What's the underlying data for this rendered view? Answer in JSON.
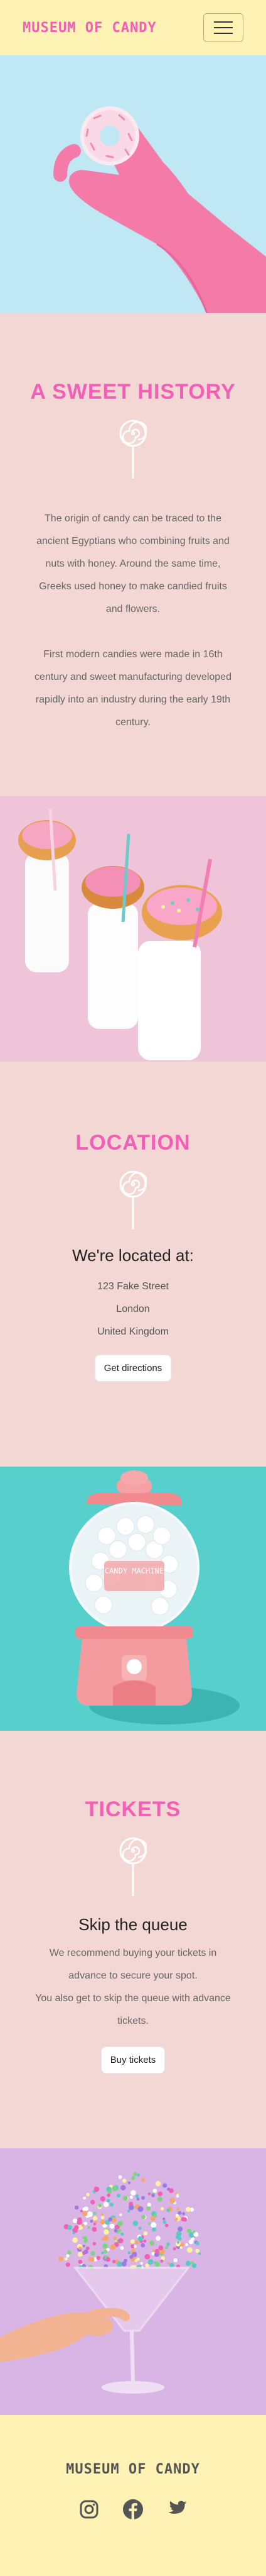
{
  "header": {
    "logo": "MUSEUM OF CANDY",
    "menu_icon": "hamburger-menu-icon"
  },
  "hero": {
    "image": "hand-in-pink-glove-holding-donut"
  },
  "history": {
    "heading": "A SWEET HISTORY",
    "icon": "lollipop-icon",
    "paragraph1": "The origin of candy can be traced to the ancient Egyptians who combining fruits and nuts with honey. Around the same time, Greeks used honey to make candied fruits and flowers.",
    "paragraph2": "First modern candies were made in 16th century and sweet manufacturing developed rapidly into an industry during the early 19th century."
  },
  "image2": {
    "image": "milk-bottles-with-donuts"
  },
  "location": {
    "heading": "LOCATION",
    "icon": "lollipop-icon",
    "subheading": "We're located at:",
    "address": [
      "123 Fake Street",
      "London",
      "United Kingdom"
    ],
    "button": "Get directions"
  },
  "image3": {
    "image": "pink-candy-machine",
    "machine_label": "CANDY MACHINE"
  },
  "tickets": {
    "heading": "TICKETS",
    "icon": "lollipop-icon",
    "subheading": "Skip the queue",
    "paragraph1": "We recommend buying your tickets in advance to secure your spot.",
    "paragraph2": "You also get to skip the queue with advance tickets.",
    "button": "Buy tickets"
  },
  "image4": {
    "image": "hand-holding-cocktail-glass-with-sprinkles"
  },
  "footer": {
    "logo": "MUSEUM OF CANDY",
    "social": [
      "instagram-icon",
      "facebook-icon",
      "twitter-icon"
    ]
  },
  "colors": {
    "accent": "#f25fb5",
    "header_bg": "#fef3b4",
    "section_bg": "#f3d7d4"
  }
}
